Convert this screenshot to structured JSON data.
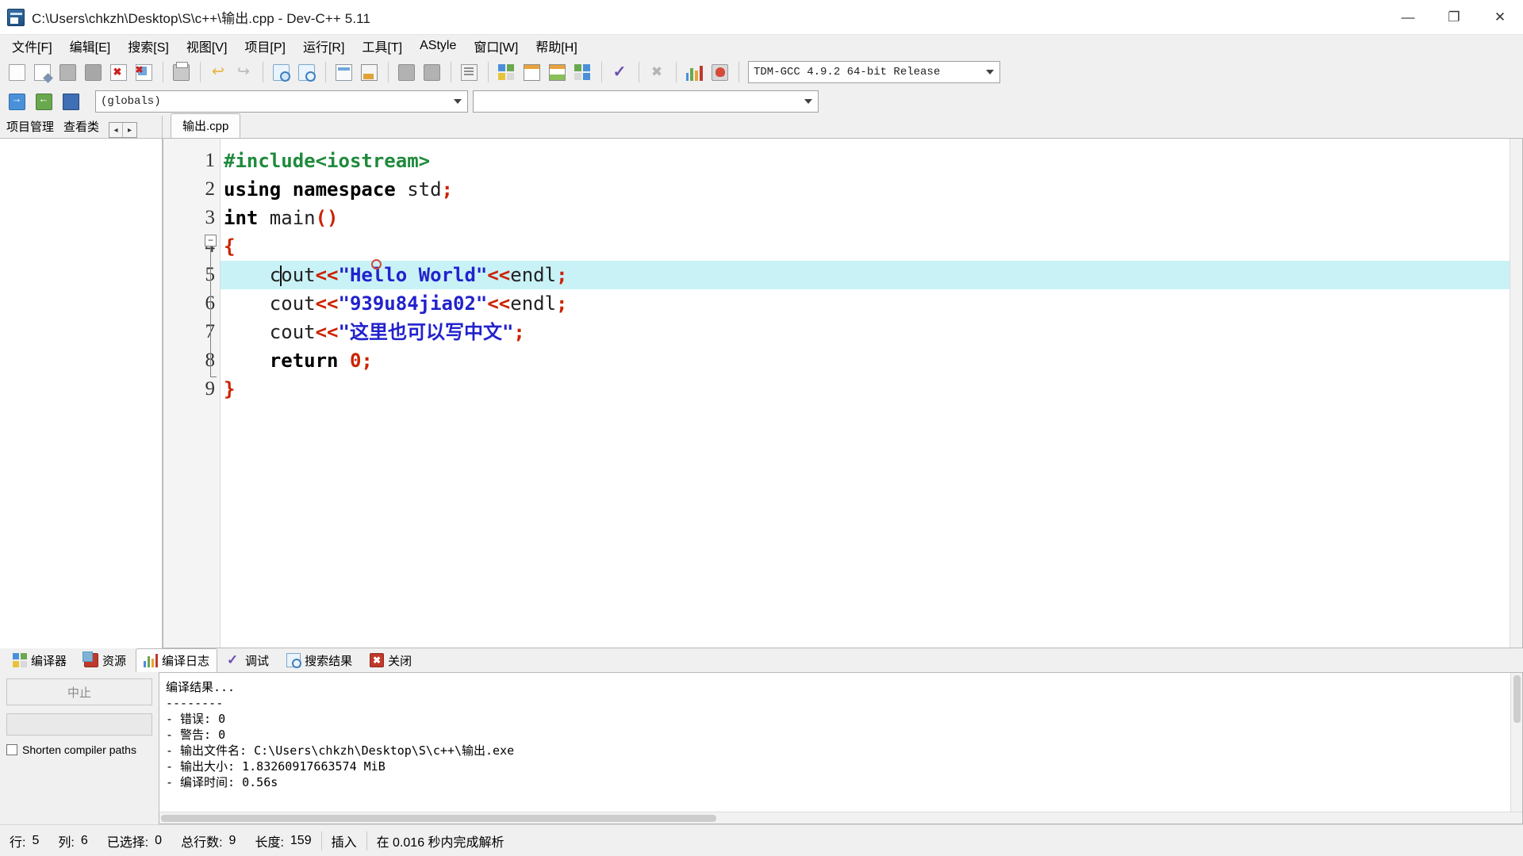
{
  "window": {
    "title": "C:\\Users\\chkzh\\Desktop\\S\\c++\\输出.cpp - Dev-C++ 5.11",
    "minimize_label": "—",
    "maximize_label": "❐",
    "close_label": "✕",
    "app_icon": "devcpp-icon"
  },
  "menubar": {
    "items": [
      {
        "label": "文件[F]",
        "name": "menu-file"
      },
      {
        "label": "编辑[E]",
        "name": "menu-edit"
      },
      {
        "label": "搜索[S]",
        "name": "menu-search"
      },
      {
        "label": "视图[V]",
        "name": "menu-view"
      },
      {
        "label": "项目[P]",
        "name": "menu-project"
      },
      {
        "label": "运行[R]",
        "name": "menu-run"
      },
      {
        "label": "工具[T]",
        "name": "menu-tools"
      },
      {
        "label": "AStyle",
        "name": "menu-astyle"
      },
      {
        "label": "窗口[W]",
        "name": "menu-window"
      },
      {
        "label": "帮助[H]",
        "name": "menu-help"
      }
    ]
  },
  "toolbar": {
    "compiler_select": "TDM-GCC 4.9.2 64-bit Release",
    "second_row_combo1": "(globals)",
    "second_row_combo2": ""
  },
  "left_panel": {
    "tabs": [
      {
        "label": "项目管理",
        "name": "tab-project-manager"
      },
      {
        "label": "查看类",
        "name": "tab-class-browser"
      }
    ],
    "scroll_left": "◂",
    "scroll_right": "▸"
  },
  "editor": {
    "tab_label": "输出.cpp",
    "line_numbers": [
      "1",
      "2",
      "3",
      "4",
      "5",
      "6",
      "7",
      "8",
      "9"
    ],
    "fold_marker": "−",
    "lines": [
      {
        "n": 1,
        "text": "#include<iostream>"
      },
      {
        "n": 2,
        "text": "using namespace std;"
      },
      {
        "n": 3,
        "text": "int main()"
      },
      {
        "n": 4,
        "text": "{"
      },
      {
        "n": 5,
        "text": "    cout<<\"Hello World\"<<endl;"
      },
      {
        "n": 6,
        "text": "    cout<<\"939u84jia02\"<<endl;"
      },
      {
        "n": 7,
        "text": "    cout<<\"这里也可以写中文\";"
      },
      {
        "n": 8,
        "text": "    return 0;"
      },
      {
        "n": 9,
        "text": "}"
      }
    ],
    "active_line": 5,
    "tokens": {
      "l1_pre": "#include<iostream>",
      "l2_kw1": "using",
      "l2_kw2": " namespace",
      "l2_id": " std",
      "l2_sym": ";",
      "l3_kw": "int",
      "l3_id": " main",
      "l3_paren": "()",
      "l4_brace": "{",
      "l5_indent": "    ",
      "l5_c": "c",
      "l5_out": "out",
      "l5_shift": "<<",
      "l5_str": "\"Hello World\"",
      "l5_shift2": "<<",
      "l5_endl": "endl",
      "l5_semi": ";",
      "l6_indent": "    ",
      "l6_cout": "cout",
      "l6_shift": "<<",
      "l6_str": "\"939u84jia02\"",
      "l6_shift2": "<<",
      "l6_endl": "endl",
      "l6_semi": ";",
      "l7_indent": "    ",
      "l7_cout": "cout",
      "l7_shift": "<<",
      "l7_str": "\"这里也可以写中文\"",
      "l7_semi": ";",
      "l8_indent": "    ",
      "l8_kw": "return",
      "l8_num": " 0",
      "l8_semi": ";",
      "l9_brace": "}"
    },
    "colors": {
      "preprocessor": "#1f8a3c",
      "keyword": "#000000",
      "symbol": "#cc2200",
      "string": "#2222cc",
      "active_line_bg": "#c9f2f7"
    }
  },
  "bottom_panel": {
    "tabs": [
      {
        "label": "编译器",
        "name": "tab-compiler",
        "icon": "grid-icon",
        "selected": false
      },
      {
        "label": "资源",
        "name": "tab-resources",
        "icon": "resource-icon",
        "selected": false
      },
      {
        "label": "编译日志",
        "name": "tab-compile-log",
        "icon": "bars-icon",
        "selected": true
      },
      {
        "label": "调试",
        "name": "tab-debug",
        "icon": "check-icon",
        "selected": false
      },
      {
        "label": "搜索结果",
        "name": "tab-search-results",
        "icon": "search-icon",
        "selected": false
      },
      {
        "label": "关闭",
        "name": "tab-close",
        "icon": "close-red-icon",
        "selected": false
      }
    ],
    "abort_button": "中止",
    "shorten_paths_label": "Shorten compiler paths",
    "log_lines": [
      "编译结果...",
      "--------",
      "- 错误: 0",
      "- 警告: 0",
      "- 输出文件名: C:\\Users\\chkzh\\Desktop\\S\\c++\\输出.exe",
      "- 输出大小: 1.83260917663574 MiB",
      "- 编译时间: 0.56s"
    ]
  },
  "statusbar": {
    "items": [
      {
        "label": "行:",
        "value": "5",
        "name": "status-line"
      },
      {
        "label": "列:",
        "value": "6",
        "name": "status-col"
      },
      {
        "label": "已选择:",
        "value": "0",
        "name": "status-selected"
      },
      {
        "label": "总行数:",
        "value": "9",
        "name": "status-total-lines"
      },
      {
        "label": "长度:",
        "value": "159",
        "name": "status-length"
      }
    ],
    "insert_mode": "插入",
    "parse_info": "在 0.016 秒内完成解析"
  }
}
